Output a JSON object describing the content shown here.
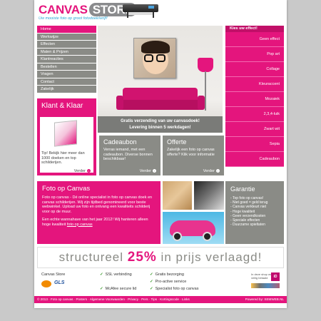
{
  "header": {
    "logo_canvas": "CANVAS",
    "logo_store": "STORE",
    "tagline": "Uw mooiste foto op groot fotodoek/wrijf!"
  },
  "nav": {
    "items": [
      "Home",
      "Werkwijze",
      "Effecten",
      "Maten & Prijzen",
      "Klantreacties",
      "Bestellen",
      "Vragen",
      "Contact",
      "Zakelijk"
    ]
  },
  "hero": {
    "line1": "Gratis verzending van uw canvasdoek!",
    "line2": "Levering binnen 5 werkdagen!"
  },
  "effects": {
    "title": "Kies uw effect!",
    "items": [
      "Geen effect",
      "Pop art",
      "Collage",
      "Kleuraccent",
      "Mozaiek",
      "2,3,4-luik",
      "Zwart wit",
      "Sepia",
      "Cadeaubon"
    ]
  },
  "klant": {
    "title": "Klant & Klaar",
    "text": "Tip! Bekijk hier meer dan 1000 doeken en top schilderijen.",
    "more": "Verder"
  },
  "cadeaubon": {
    "title": "Cadeaubon",
    "text": "Verras iemand, met een cadeaubon. Diverse bonnen beschikbaar!",
    "more": "Verder"
  },
  "offerte": {
    "title": "Offerte",
    "text": "Zakelijk een foto op canvas offerte? Klik voor informatie",
    "more": "Verder"
  },
  "foto_op_canvas": {
    "title": "Foto op Canvas",
    "p1": "Foto op canvas - Dé online specialist in foto op canvas doek en canvas schilderijen. Wij zijn tijdbed genomineerd voor beste webwinkel. Upload uw foto en ontvang een kwaliteits schilderij voor op de muur.",
    "p2": "Een echte wannahave van het jaar 2012! Wij hanteren alleen hoge kwaliteit",
    "p2_link": "foto op canvas"
  },
  "garantie": {
    "title": "Garantie",
    "items": [
      "- Top foto op canvas!",
      "- Niet goed = geld terug",
      "- Canvas verkleurt niet",
      "- Hoge kwaliteit",
      "- Geen verzendkosten",
      "- Speciale effecten",
      "- Duurzame spieltaten"
    ]
  },
  "promo": {
    "before": "structureel",
    "pct": "25%",
    "after": "in prijs verlaagd!"
  },
  "trust": {
    "title": "Canvas Store",
    "pay_logo": "GLS",
    "checks": [
      "SSL verbinding",
      "Gratis bezorging",
      "Pro-active service",
      "McAfee secure lid",
      "Specialist foto op canvas"
    ],
    "ideal_caption": "In deze shop wordt veilig betaald",
    "ideal_box": "iD"
  },
  "footer": {
    "left": "© 2013 · Foto op canvas · Posters · Algemene Voorwaarden · Privacy · Pers · Tips · Kortingscode · Links",
    "right": "Powered by: SEMWEB.NL"
  },
  "colors": {
    "accent": "#e4157d",
    "grey": "#8a8b86",
    "link": "#2ca7d6"
  }
}
